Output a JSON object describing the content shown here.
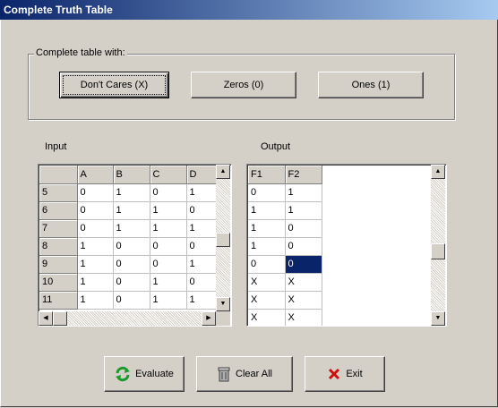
{
  "window": {
    "title": "Complete Truth Table"
  },
  "group": {
    "legend": "Complete table with:",
    "buttons": [
      "Don't Cares (X)",
      "Zeros (0)",
      "Ones (1)"
    ]
  },
  "input": {
    "label": "Input",
    "headers": [
      "",
      "A",
      "B",
      "C",
      "D"
    ],
    "rows": [
      [
        "5",
        "0",
        "1",
        "0",
        "1"
      ],
      [
        "6",
        "0",
        "1",
        "1",
        "0"
      ],
      [
        "7",
        "0",
        "1",
        "1",
        "1"
      ],
      [
        "8",
        "1",
        "0",
        "0",
        "0"
      ],
      [
        "9",
        "1",
        "0",
        "0",
        "1"
      ],
      [
        "10",
        "1",
        "0",
        "1",
        "0"
      ],
      [
        "11",
        "1",
        "0",
        "1",
        "1"
      ]
    ]
  },
  "output": {
    "label": "Output",
    "headers": [
      "F1",
      "F2"
    ],
    "rows": [
      [
        "0",
        "1"
      ],
      [
        "1",
        "1"
      ],
      [
        "1",
        "0"
      ],
      [
        "1",
        "0"
      ],
      [
        "0",
        "0"
      ],
      [
        "X",
        "X"
      ],
      [
        "X",
        "X"
      ],
      [
        "X",
        "X"
      ]
    ]
  },
  "actions": {
    "evaluate": "Evaluate",
    "clear_all": "Clear All",
    "exit": "Exit"
  },
  "colors": {
    "selection": "#0a246a",
    "evaluate_icon": "#1a9a2a",
    "exit_icon": "#cc1010"
  }
}
